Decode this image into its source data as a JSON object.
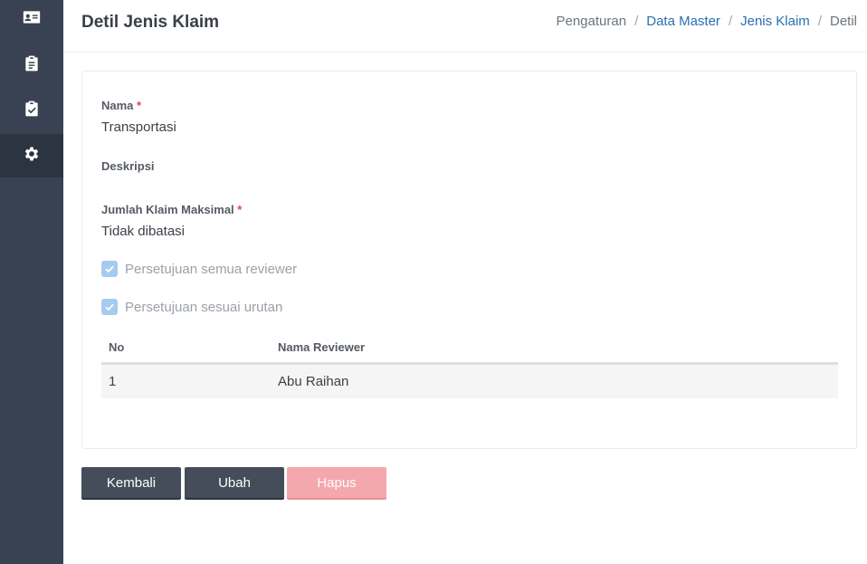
{
  "sidebar": {
    "items": [
      {
        "icon": "id-card-icon",
        "active": false
      },
      {
        "icon": "clipboard-list-icon",
        "active": false
      },
      {
        "icon": "clipboard-check-icon",
        "active": false
      },
      {
        "icon": "gear-icon",
        "active": true
      }
    ]
  },
  "header": {
    "title": "Detil Jenis Klaim",
    "breadcrumb": {
      "item1": "Pengaturan",
      "item2": "Data Master",
      "item3": "Jenis Klaim",
      "item4": "Detil",
      "separator": "/"
    }
  },
  "form": {
    "nama_label": "Nama",
    "nama_value": "Transportasi",
    "deskripsi_label": "Deskripsi",
    "deskripsi_value": "",
    "jumlah_label": "Jumlah Klaim Maksimal",
    "jumlah_value": "Tidak dibatasi",
    "required_marker": "*",
    "check_all_label": "Persetujuan semua reviewer",
    "check_all_checked": true,
    "check_order_label": "Persetujuan sesuai urutan",
    "check_order_checked": true
  },
  "table": {
    "col_no": "No",
    "col_name": "Nama Reviewer",
    "rows": [
      {
        "no": "1",
        "name": "Abu Raihan"
      }
    ]
  },
  "buttons": {
    "back": "Kembali",
    "edit": "Ubah",
    "delete": "Hapus"
  },
  "colors": {
    "sidebar": "#394252",
    "link": "#2a6fb0",
    "required": "#e0434b",
    "button_dark": "#454d5a",
    "button_danger": "#f5a7ae",
    "checkbox": "#a7cbef"
  }
}
